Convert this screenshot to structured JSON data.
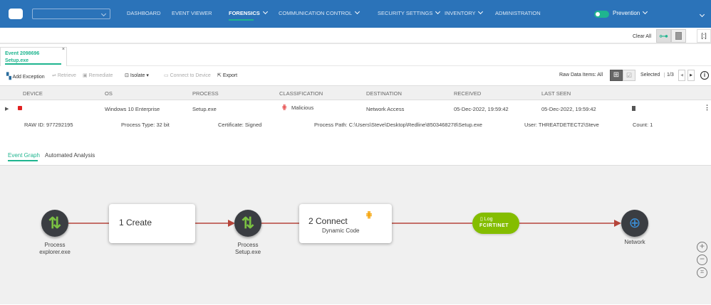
{
  "header": {
    "nav": [
      {
        "label": "DASHBOARD"
      },
      {
        "label": "EVENT VIEWER"
      },
      {
        "label": "FORENSICS"
      },
      {
        "label": "COMMUNICATION CONTROL"
      },
      {
        "label": "SECURITY SETTINGS"
      },
      {
        "label": "INVENTORY"
      },
      {
        "label": "ADMINISTRATION"
      }
    ],
    "mode": "Prevention",
    "org_select": ""
  },
  "subbar": {
    "clear_all": "Clear All"
  },
  "tab": {
    "line1": "Event 2098696",
    "line2": "Setup.exe"
  },
  "toolbar": {
    "add_exception": "Add Exception",
    "retrieve": "Retrieve",
    "remediate": "Remediate",
    "isolate": "Isolate",
    "connect": "Connect to Device",
    "export": "Export",
    "raw_items": "Raw Data Items: All",
    "selected": "Selected",
    "page": "1/3"
  },
  "table": {
    "columns": [
      "DEVICE",
      "OS",
      "PROCESS",
      "CLASSIFICATION",
      "DESTINATION",
      "RECEIVED",
      "LAST SEEN"
    ],
    "row": {
      "os": "Windows 10 Enterprise",
      "process": "Setup.exe",
      "classification": "Malicious",
      "destination": "Network Access",
      "received": "05-Dec-2022, 19:59:42",
      "last_seen": "05-Dec-2022, 19:59:42"
    },
    "details": {
      "raw_id": "RAW ID: 977292195",
      "process_type": "Process Type: 32 bit",
      "certificate": "Certificate: Signed",
      "path": "Process Path: C:\\Users\\Steve\\Desktop\\Redline\\8503468278\\Setup.exe",
      "user": "User: THREATDETECT2\\Steve",
      "count": "Count: 1"
    }
  },
  "subtabs": [
    "Event Graph",
    "Automated Analysis"
  ],
  "graph": {
    "n1": {
      "l1": "Process",
      "l2": "explorer.exe"
    },
    "e1": "1 Create",
    "n2": {
      "l1": "Process",
      "l2": "Setup.exe"
    },
    "e2": {
      "title": "2 Connect",
      "sub": "Dynamic Code"
    },
    "log": {
      "label": "Log",
      "brand": "FCIRTINET"
    },
    "n3": "Network"
  },
  "colors": {
    "header": "#2b73b9",
    "accent": "#1fb58f",
    "edge": "#b5443a",
    "log": "#84bd00"
  }
}
